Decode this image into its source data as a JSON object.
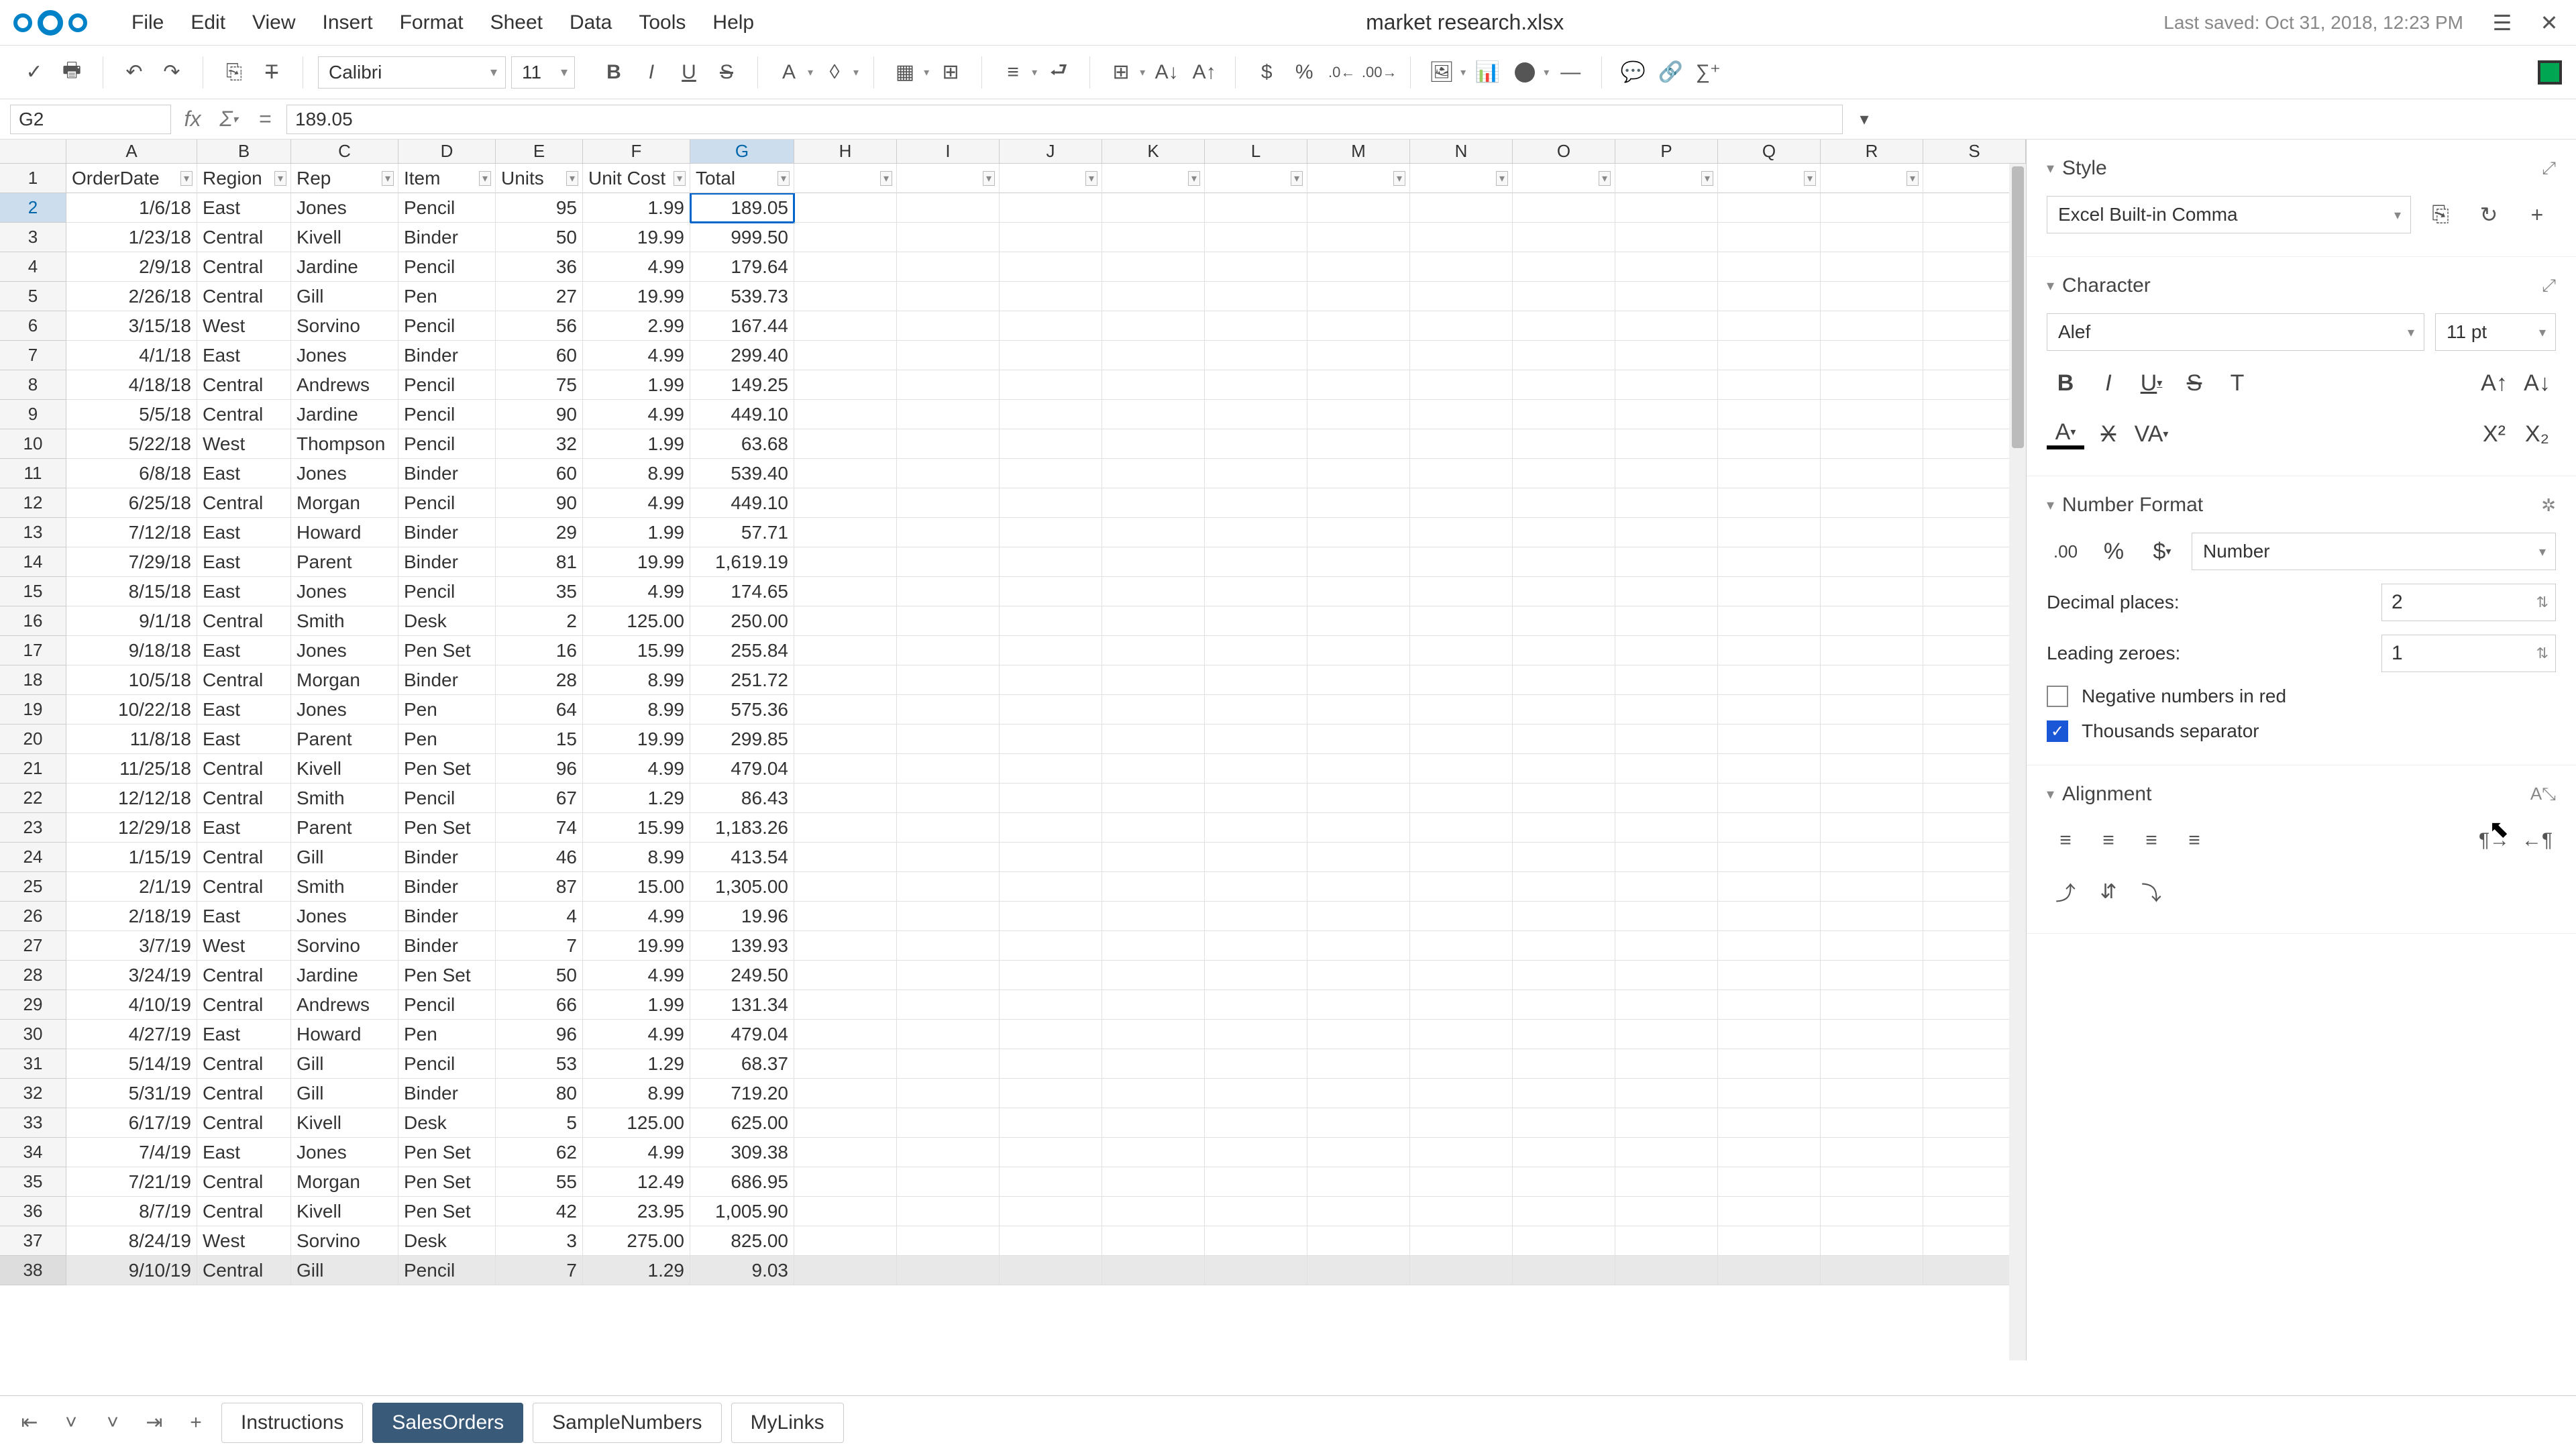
{
  "app": {
    "title": "market research.xlsx",
    "last_saved": "Last saved: Oct 31, 2018, 12:23 PM"
  },
  "menu": [
    "File",
    "Edit",
    "View",
    "Insert",
    "Format",
    "Sheet",
    "Data",
    "Tools",
    "Help"
  ],
  "toolbar": {
    "font": "Calibri",
    "size": "11"
  },
  "formula": {
    "cell_ref": "G2",
    "value": "189.05"
  },
  "columns": [
    "A",
    "B",
    "C",
    "D",
    "E",
    "F",
    "G",
    "H",
    "I",
    "J",
    "K",
    "L",
    "M",
    "N",
    "O",
    "P",
    "Q",
    "R",
    "S"
  ],
  "headers": [
    "OrderDate",
    "Region",
    "Rep",
    "Item",
    "Units",
    "Unit Cost",
    "Total"
  ],
  "selected": {
    "row": 2,
    "col": "G"
  },
  "rows": [
    [
      "1/6/18",
      "East",
      "Jones",
      "Pencil",
      "95",
      "1.99",
      "189.05"
    ],
    [
      "1/23/18",
      "Central",
      "Kivell",
      "Binder",
      "50",
      "19.99",
      "999.50"
    ],
    [
      "2/9/18",
      "Central",
      "Jardine",
      "Pencil",
      "36",
      "4.99",
      "179.64"
    ],
    [
      "2/26/18",
      "Central",
      "Gill",
      "Pen",
      "27",
      "19.99",
      "539.73"
    ],
    [
      "3/15/18",
      "West",
      "Sorvino",
      "Pencil",
      "56",
      "2.99",
      "167.44"
    ],
    [
      "4/1/18",
      "East",
      "Jones",
      "Binder",
      "60",
      "4.99",
      "299.40"
    ],
    [
      "4/18/18",
      "Central",
      "Andrews",
      "Pencil",
      "75",
      "1.99",
      "149.25"
    ],
    [
      "5/5/18",
      "Central",
      "Jardine",
      "Pencil",
      "90",
      "4.99",
      "449.10"
    ],
    [
      "5/22/18",
      "West",
      "Thompson",
      "Pencil",
      "32",
      "1.99",
      "63.68"
    ],
    [
      "6/8/18",
      "East",
      "Jones",
      "Binder",
      "60",
      "8.99",
      "539.40"
    ],
    [
      "6/25/18",
      "Central",
      "Morgan",
      "Pencil",
      "90",
      "4.99",
      "449.10"
    ],
    [
      "7/12/18",
      "East",
      "Howard",
      "Binder",
      "29",
      "1.99",
      "57.71"
    ],
    [
      "7/29/18",
      "East",
      "Parent",
      "Binder",
      "81",
      "19.99",
      "1,619.19"
    ],
    [
      "8/15/18",
      "East",
      "Jones",
      "Pencil",
      "35",
      "4.99",
      "174.65"
    ],
    [
      "9/1/18",
      "Central",
      "Smith",
      "Desk",
      "2",
      "125.00",
      "250.00"
    ],
    [
      "9/18/18",
      "East",
      "Jones",
      "Pen Set",
      "16",
      "15.99",
      "255.84"
    ],
    [
      "10/5/18",
      "Central",
      "Morgan",
      "Binder",
      "28",
      "8.99",
      "251.72"
    ],
    [
      "10/22/18",
      "East",
      "Jones",
      "Pen",
      "64",
      "8.99",
      "575.36"
    ],
    [
      "11/8/18",
      "East",
      "Parent",
      "Pen",
      "15",
      "19.99",
      "299.85"
    ],
    [
      "11/25/18",
      "Central",
      "Kivell",
      "Pen Set",
      "96",
      "4.99",
      "479.04"
    ],
    [
      "12/12/18",
      "Central",
      "Smith",
      "Pencil",
      "67",
      "1.29",
      "86.43"
    ],
    [
      "12/29/18",
      "East",
      "Parent",
      "Pen Set",
      "74",
      "15.99",
      "1,183.26"
    ],
    [
      "1/15/19",
      "Central",
      "Gill",
      "Binder",
      "46",
      "8.99",
      "413.54"
    ],
    [
      "2/1/19",
      "Central",
      "Smith",
      "Binder",
      "87",
      "15.00",
      "1,305.00"
    ],
    [
      "2/18/19",
      "East",
      "Jones",
      "Binder",
      "4",
      "4.99",
      "19.96"
    ],
    [
      "3/7/19",
      "West",
      "Sorvino",
      "Binder",
      "7",
      "19.99",
      "139.93"
    ],
    [
      "3/24/19",
      "Central",
      "Jardine",
      "Pen Set",
      "50",
      "4.99",
      "249.50"
    ],
    [
      "4/10/19",
      "Central",
      "Andrews",
      "Pencil",
      "66",
      "1.99",
      "131.34"
    ],
    [
      "4/27/19",
      "East",
      "Howard",
      "Pen",
      "96",
      "4.99",
      "479.04"
    ],
    [
      "5/14/19",
      "Central",
      "Gill",
      "Pencil",
      "53",
      "1.29",
      "68.37"
    ],
    [
      "5/31/19",
      "Central",
      "Gill",
      "Binder",
      "80",
      "8.99",
      "719.20"
    ],
    [
      "6/17/19",
      "Central",
      "Kivell",
      "Desk",
      "5",
      "125.00",
      "625.00"
    ],
    [
      "7/4/19",
      "East",
      "Jones",
      "Pen Set",
      "62",
      "4.99",
      "309.38"
    ],
    [
      "7/21/19",
      "Central",
      "Morgan",
      "Pen Set",
      "55",
      "12.49",
      "686.95"
    ],
    [
      "8/7/19",
      "Central",
      "Kivell",
      "Pen Set",
      "42",
      "23.95",
      "1,005.90"
    ],
    [
      "8/24/19",
      "West",
      "Sorvino",
      "Desk",
      "3",
      "275.00",
      "825.00"
    ],
    [
      "9/10/19",
      "Central",
      "Gill",
      "Pencil",
      "7",
      "1.29",
      "9.03"
    ]
  ],
  "sidebar": {
    "style": {
      "title": "Style",
      "select": "Excel Built-in Comma"
    },
    "character": {
      "title": "Character",
      "font": "Alef",
      "size": "11 pt"
    },
    "numfmt": {
      "title": "Number Format",
      "type": "Number",
      "dec_label": "Decimal places:",
      "dec": "2",
      "lz_label": "Leading zeroes:",
      "lz": "1",
      "neg": "Negative numbers in red",
      "thou": "Thousands separator"
    },
    "align": {
      "title": "Alignment"
    }
  },
  "tabs": [
    "Instructions",
    "SalesOrders",
    "SampleNumbers",
    "MyLinks"
  ],
  "active_tab": 1
}
